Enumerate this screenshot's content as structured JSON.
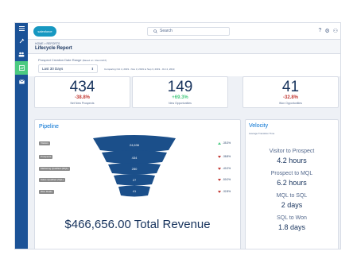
{
  "brand": {
    "logo_text": "salesforce",
    "accent": "#0070d2",
    "nav_bg": "#1b5297",
    "nav_active": "#4bca81"
  },
  "leftnav": {
    "icons": [
      "menu-icon",
      "tools-icon",
      "users-icon",
      "chart-icon",
      "mail-icon"
    ]
  },
  "topbar": {
    "search_placeholder": "Search",
    "icons": [
      "help-icon",
      "gear-icon",
      "user-icon"
    ],
    "icon_glyphs": [
      "?",
      "⚙",
      "⚇"
    ]
  },
  "header": {
    "breadcrumb": "HOME > REPORTS",
    "title": "Lifecycle Report"
  },
  "filters": {
    "label": "Prospect Creation Date Range",
    "label_note": "(Based on: Client EST)",
    "selected": "Last 30 Days",
    "comparing": "Comparing Oct 4, 2019 - Nov 3, 2019 to Sep 3, 2019 - Oct 4, 2019"
  },
  "kpis": [
    {
      "value": "434",
      "change": "-38.8%",
      "label": "Net New Prospects",
      "color": "#c23934"
    },
    {
      "value": "149",
      "change": "+69.3%",
      "label": "New Opportunities",
      "color": "#4bca81"
    },
    {
      "value": "41",
      "change": "-32.8%",
      "label": "Won Opportunities",
      "color": "#c23934"
    }
  ],
  "pipeline": {
    "title": "Pipeline",
    "stages": [
      {
        "label": "Visitors",
        "value": "24,636",
        "conversion": "-35.3%",
        "direction": "up"
      },
      {
        "label": "Prospects",
        "value": "434",
        "conversion": "-38.8%",
        "direction": "down"
      },
      {
        "label": "Marketing Qualified (MQL)",
        "value": "280",
        "conversion": "-40.2%",
        "direction": "down"
      },
      {
        "label": "Sales Qualified (SQL)",
        "value": "27",
        "conversion": "-50.0%",
        "direction": "down"
      },
      {
        "label": "Won Deals",
        "value": "41",
        "conversion": "-32.8%",
        "direction": "down"
      }
    ],
    "revenue": "$466,656.00 Total Revenue"
  },
  "velocity": {
    "title": "Velocity",
    "subtitle": "Average Transition Time",
    "items": [
      {
        "label": "Visitor to Prospect",
        "value": "4.2 hours"
      },
      {
        "label": "Prospect to MQL",
        "value": "6.2 hours"
      },
      {
        "label": "MQL to SQL",
        "value": "2 days"
      },
      {
        "label": "SQL to Won",
        "value": "1.8 days"
      }
    ]
  }
}
